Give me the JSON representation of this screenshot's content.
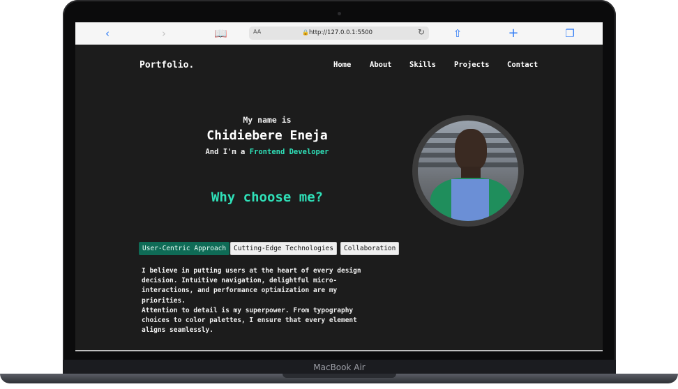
{
  "device": {
    "label": "MacBook Air"
  },
  "browser": {
    "reader_label": "AA",
    "url": "http://127.0.0.1:5500"
  },
  "site": {
    "logo": "Portfolio.",
    "nav": [
      "Home",
      "About",
      "Skills",
      "Projects",
      "Contact"
    ],
    "intro": "My name is",
    "name": "Chidiebere Eneja",
    "role_prefix": "And I'm a",
    "role_highlight": "Frontend Developer",
    "why_title": "Why choose me?",
    "tabs": [
      "User-Centric Approach",
      "Cutting-Edge Technologies",
      "Collaboration"
    ],
    "active_tab": "User-Centric Approach",
    "paragraph_1": "I believe in putting users at the heart of every design decision. Intuitive navigation, delightful micro-interactions, and performance optimization are my priorities.",
    "paragraph_2": "Attention to detail is my superpower. From typography choices to color palettes, I ensure that every element aligns seamlessly."
  },
  "colors": {
    "accent": "#2fe0b8",
    "active_tab_bg": "#0f6b56",
    "page_bg": "#1c1c1c",
    "safari_blue": "#2f7bf5"
  },
  "icons": [
    "back-icon",
    "forward-icon",
    "bookmarks-icon",
    "lock-icon",
    "reload-icon",
    "share-icon",
    "new-tab-icon",
    "tabs-overview-icon"
  ]
}
